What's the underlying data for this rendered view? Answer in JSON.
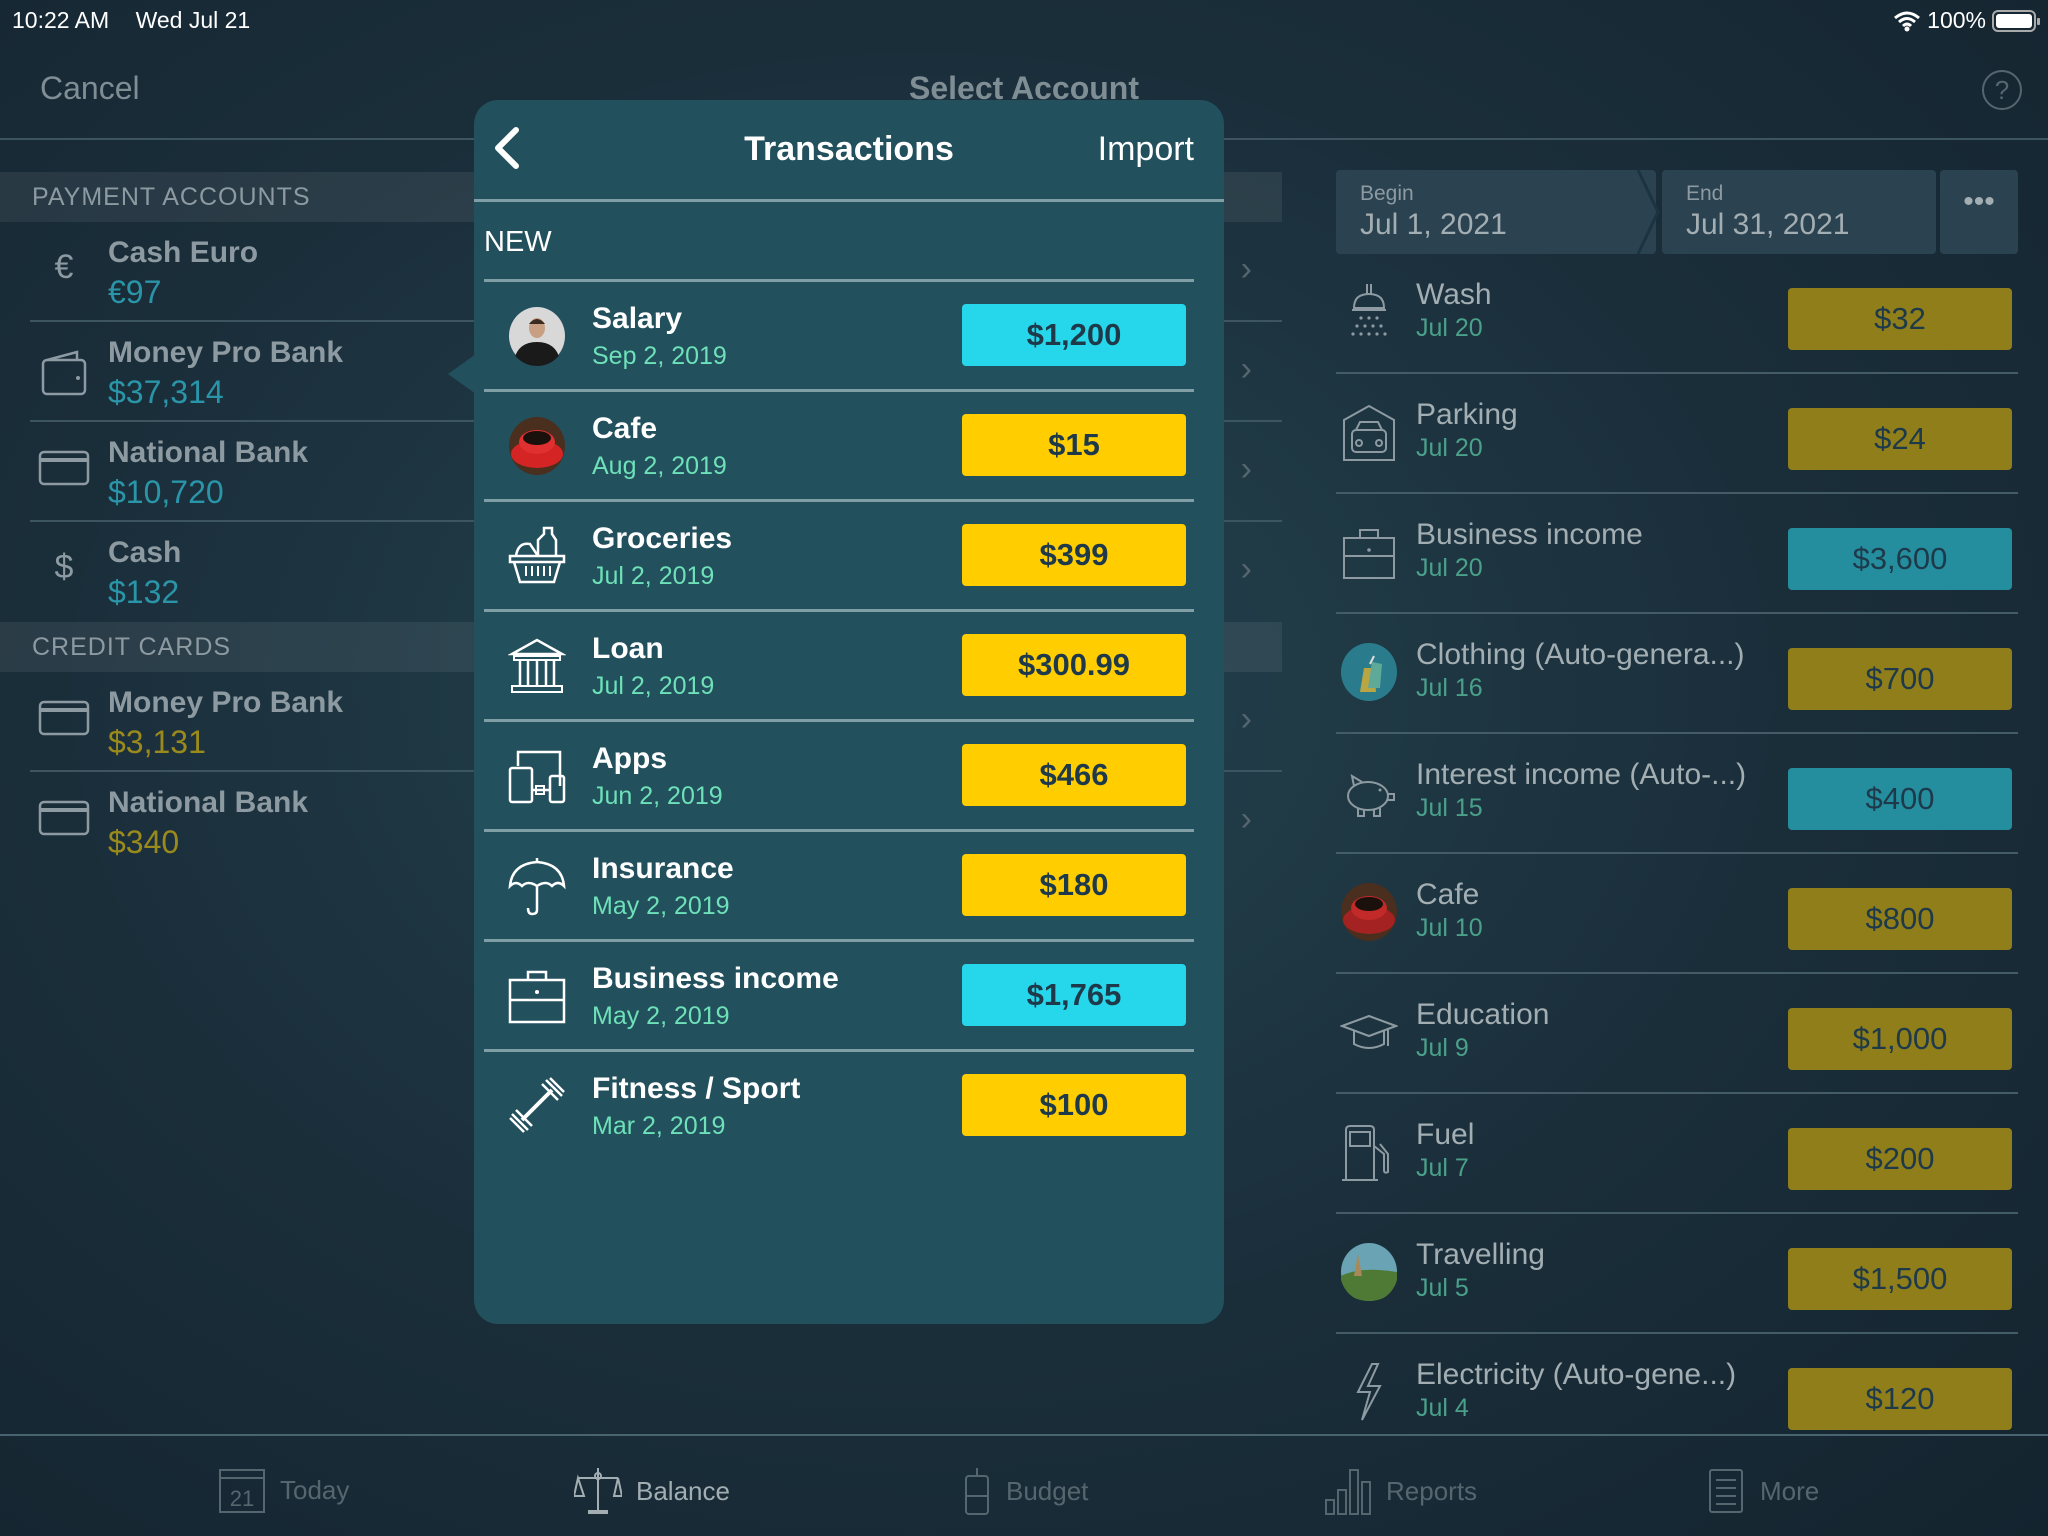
{
  "status_bar": {
    "time": "10:22 AM",
    "date": "Wed Jul 21",
    "battery": "100%",
    "battery_level": 1.0
  },
  "nav": {
    "cancel": "Cancel",
    "title": "Select Account",
    "help": "?"
  },
  "accounts": {
    "sections": [
      {
        "title": "PAYMENT ACCOUNTS",
        "items": [
          {
            "name": "Cash Euro",
            "balance": "€97",
            "icon": "euro-icon",
            "tone": "blue"
          },
          {
            "name": "Money Pro Bank",
            "balance": "$37,314",
            "icon": "wallet-icon",
            "tone": "blue"
          },
          {
            "name": "National Bank",
            "balance": "$10,720",
            "icon": "card-icon",
            "tone": "blue"
          },
          {
            "name": "Cash",
            "balance": "$132",
            "icon": "dollar-icon",
            "tone": "blue"
          }
        ]
      },
      {
        "title": "CREDIT CARDS",
        "items": [
          {
            "name": "Money Pro Bank",
            "balance": "$3,131",
            "icon": "card-icon",
            "tone": "gold"
          },
          {
            "name": "National Bank",
            "balance": "$340",
            "icon": "card-icon",
            "tone": "gold"
          }
        ]
      }
    ]
  },
  "period": {
    "begin_label": "Begin",
    "begin": "Jul 1, 2021",
    "end_label": "End",
    "end": "Jul 31, 2021",
    "more": "•••"
  },
  "transactions": [
    {
      "name": "Wash",
      "date": "Jul 20",
      "amount": "$32",
      "type": "expense",
      "icon": "shower-icon"
    },
    {
      "name": "Parking",
      "date": "Jul 20",
      "amount": "$24",
      "type": "expense",
      "icon": "garage-car-icon"
    },
    {
      "name": "Business income",
      "date": "Jul 20",
      "amount": "$3,600",
      "type": "income",
      "icon": "briefcase-icon"
    },
    {
      "name": "Clothing (Auto-genera...)",
      "date": "Jul 16",
      "amount": "$700",
      "type": "expense",
      "icon": "shopping-bags-photo"
    },
    {
      "name": "Interest income (Auto-...)",
      "date": "Jul 15",
      "amount": "$400",
      "type": "income",
      "icon": "piggy-bank-icon"
    },
    {
      "name": "Cafe",
      "date": "Jul 10",
      "amount": "$800",
      "type": "expense",
      "icon": "coffee-cup-photo"
    },
    {
      "name": "Education",
      "date": "Jul 9",
      "amount": "$1,000",
      "type": "expense",
      "icon": "graduation-cap-icon"
    },
    {
      "name": "Fuel",
      "date": "Jul 7",
      "amount": "$200",
      "type": "expense",
      "icon": "fuel-pump-icon"
    },
    {
      "name": "Travelling",
      "date": "Jul 5",
      "amount": "$1,500",
      "type": "expense",
      "icon": "landscape-photo"
    },
    {
      "name": "Electricity (Auto-gene...)",
      "date": "Jul 4",
      "amount": "$120",
      "type": "expense",
      "icon": "lightning-icon"
    }
  ],
  "popover": {
    "title": "Transactions",
    "import": "Import",
    "section": "NEW",
    "items": [
      {
        "name": "Salary",
        "date": "Sep 2, 2019",
        "amount": "$1,200",
        "type": "income",
        "icon": "person-photo"
      },
      {
        "name": "Cafe",
        "date": "Aug 2, 2019",
        "amount": "$15",
        "type": "expense",
        "icon": "coffee-cup-photo"
      },
      {
        "name": "Groceries",
        "date": "Jul 2, 2019",
        "amount": "$399",
        "type": "expense",
        "icon": "grocery-basket-icon"
      },
      {
        "name": "Loan",
        "date": "Jul 2, 2019",
        "amount": "$300.99",
        "type": "expense",
        "icon": "bank-building-icon"
      },
      {
        "name": "Apps",
        "date": "Jun 2, 2019",
        "amount": "$466",
        "type": "expense",
        "icon": "devices-icon"
      },
      {
        "name": "Insurance",
        "date": "May 2, 2019",
        "amount": "$180",
        "type": "expense",
        "icon": "umbrella-icon"
      },
      {
        "name": "Business income",
        "date": "May 2, 2019",
        "amount": "$1,765",
        "type": "income",
        "icon": "briefcase-icon"
      },
      {
        "name": "Fitness / Sport",
        "date": "Mar 2, 2019",
        "amount": "$100",
        "type": "expense",
        "icon": "dumbbell-icon"
      }
    ]
  },
  "tabs": [
    {
      "label": "Today",
      "icon": "calendar-icon",
      "calendar_day": "21",
      "active": false
    },
    {
      "label": "Balance",
      "icon": "scales-icon",
      "active": true
    },
    {
      "label": "Budget",
      "icon": "jar-icon",
      "active": false
    },
    {
      "label": "Reports",
      "icon": "bar-chart-icon",
      "active": false
    },
    {
      "label": "More",
      "icon": "list-doc-icon",
      "active": false
    }
  ],
  "colors": {
    "income": "#26d6ea",
    "expense": "#ffcd00",
    "income_dim": "#248e9f",
    "expense_dim": "#8f7e1a",
    "popover_bg": "#22505d",
    "date_green": "#6ee1b8"
  }
}
